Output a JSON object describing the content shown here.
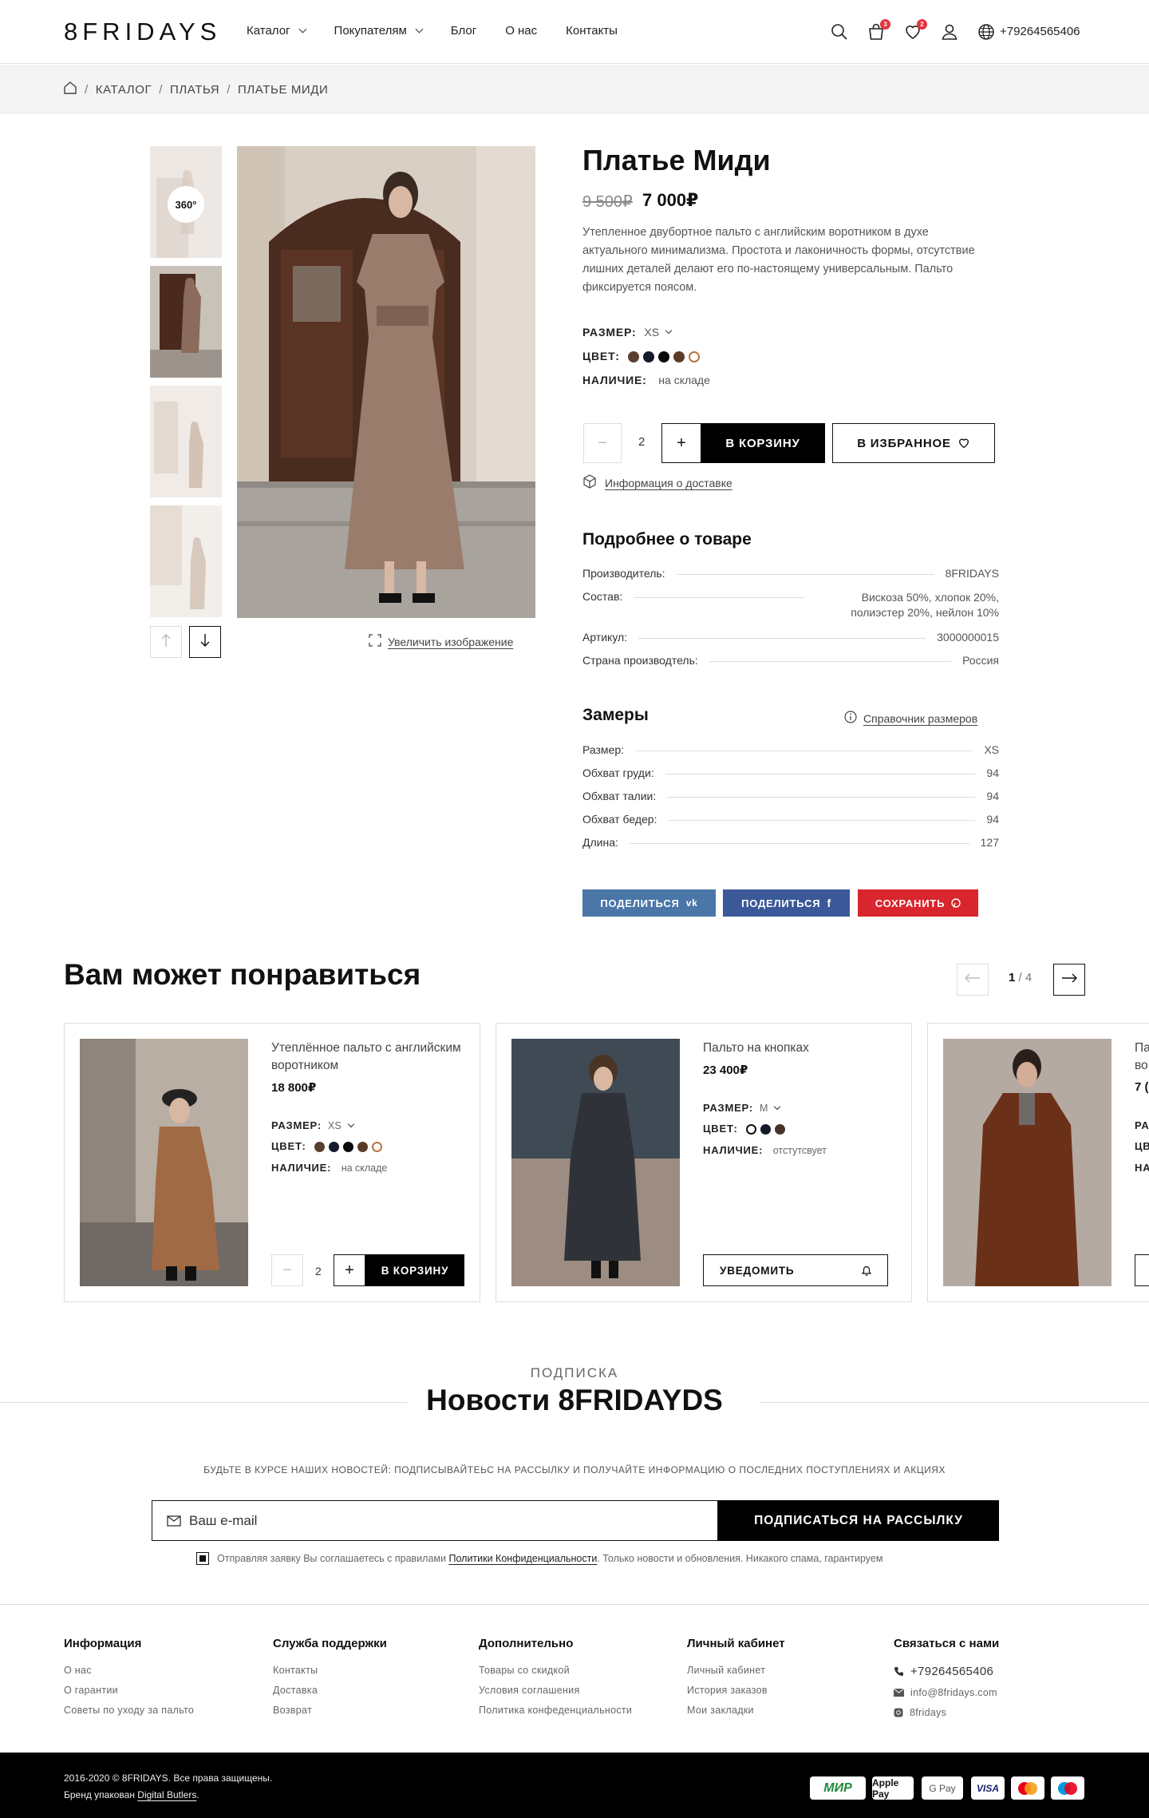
{
  "header": {
    "logo": "8FRIDAYS",
    "nav": [
      {
        "label": "Каталог",
        "has_dropdown": true
      },
      {
        "label": "Покупателям",
        "has_dropdown": true
      },
      {
        "label": "Блог",
        "has_dropdown": false
      },
      {
        "label": "О нас",
        "has_dropdown": false
      },
      {
        "label": "Контакты",
        "has_dropdown": false
      }
    ],
    "icons": [
      "search-icon",
      "cart-icon",
      "heart-icon",
      "user-icon",
      "globe-icon"
    ],
    "cart_count": "3",
    "wishlist_count": "2",
    "phone": "+79264565406"
  },
  "breadcrumb": {
    "icon": "home-icon",
    "items": [
      "КАТАЛОГ",
      "ПЛАТЬЯ",
      "ПЛАТЬЕ МИДИ"
    ],
    "separator": "/"
  },
  "gallery": {
    "badge_360": "360°",
    "zoom_label": "Увеличить изображение",
    "prev_icon": "arrow-up-icon",
    "next_icon": "arrow-down-icon",
    "thumbs_count": 4,
    "active_thumb": 2
  },
  "product": {
    "title": "Платье Миди",
    "old_price": "9 500₽",
    "price": "7 000₽",
    "description": "Утепленное двубортное пальто с английским воротником в духе актуального минимализма. Простота и лаконичность формы, отсутствие лишних деталей делают его по-настоящему универсальным. Пальто фиксируется поясом.",
    "size_label": "РАЗМЕР:",
    "size_value": "XS",
    "color_label": "ЦВЕТ:",
    "colors": [
      "#5a3e2e",
      "#151a2a",
      "#0a0a0a",
      "#5b3b27",
      "#b8733f"
    ],
    "selected_color_index": 4,
    "stock_label": "НАЛИЧИЕ:",
    "stock_value": "на складе",
    "quantity": "2",
    "add_to_cart": "В КОРЗИНУ",
    "add_to_wishlist": "В ИЗБРАННОЕ",
    "delivery_link": "Информация о доставке"
  },
  "details": {
    "title": "Подробнее о товаре",
    "rows": [
      {
        "key": "Производитель:",
        "value": "8FRIDAYS"
      },
      {
        "key": "Состав:",
        "value": "Вискоза 50%, хлопок 20%, полиэстер 20%, нейлон 10%"
      },
      {
        "key": "Артикул:",
        "value": "3000000015"
      },
      {
        "key": "Страна производтель:",
        "value": "Россия"
      }
    ]
  },
  "measurements": {
    "title": "Замеры",
    "guide_link": "Справочник размеров",
    "rows": [
      {
        "key": "Размер:",
        "value": "XS"
      },
      {
        "key": "Обхват груди:",
        "value": "94"
      },
      {
        "key": "Обхват талии:",
        "value": "94"
      },
      {
        "key": "Обхват бедер:",
        "value": "94"
      },
      {
        "key": "Длина:",
        "value": "127"
      }
    ]
  },
  "share": [
    {
      "label": "ПОДЕЛИТЬСЯ",
      "icon": "vk-icon",
      "color": "#4a76a8"
    },
    {
      "label": "ПОДЕЛИТЬСЯ",
      "icon": "facebook-icon",
      "color": "#3b5998"
    },
    {
      "label": "СОХРАНИТЬ",
      "icon": "pinterest-icon",
      "color": "#d9252d"
    }
  ],
  "recommend": {
    "title": "Вам может понравиться",
    "page_current": "1",
    "page_total": "/ 4",
    "cards": [
      {
        "name": "Утеплённое пальто с английским воротником",
        "price": "18 800₽",
        "size_label": "РАЗМЕР:",
        "size": "XS",
        "color_label": "ЦВЕТ:",
        "colors": [
          "#5a3e2e",
          "#151a2a",
          "#0a0a0a",
          "#5b3b27",
          "#b8733f"
        ],
        "stock_label": "НАЛИЧИЕ:",
        "stock": "на складе",
        "quantity": "2",
        "action": "В КОРЗИНУ"
      },
      {
        "name": "Пальто на кнопках",
        "price": "23 400₽",
        "size_label": "РАЗМЕР:",
        "size": "M",
        "color_label": "ЦВЕТ:",
        "colors": [
          "#ffffff",
          "#151a2a",
          "#4a3226"
        ],
        "stock_label": "НАЛИЧИЕ:",
        "stock": "отстутсвует",
        "action": "УВЕДОМИТЬ"
      },
      {
        "name": "Па во",
        "price": "7 (",
        "size_label": "РА",
        "color_label": "ЦВ",
        "stock_label": "НА"
      }
    ]
  },
  "subscribe": {
    "label": "ПОДПИСКА",
    "title": "Новости 8FRIDAYDS",
    "text": "БУДЬТЕ В КУРСЕ НАШИХ НОВОСТЕЙ: ПОДПИСЫВАЙТЕЬС НА РАССЫЛКУ И ПОЛУЧАЙТЕ ИНФОРМАЦИЮ О ПОСЛЕДНИХ ПОСТУПЛЕНИЯХ И АКЦИЯХ",
    "email_placeholder": "Ваш e-mail",
    "button": "ПОДПИСАТЬСЯ НА РАССЫЛКУ",
    "agree_before": "Отправляя заявку Вы соглашаетесь с правилами ",
    "agree_link": "Политики Конфиденциальности",
    "agree_after": ". Только новости и обновления. Никакого спама, гарантируем"
  },
  "footer": {
    "columns": [
      {
        "title": "Информация",
        "links": [
          "О нас",
          "О гарантии",
          "Советы по уходу за пальто"
        ]
      },
      {
        "title": "Служба поддержки",
        "links": [
          "Контакты",
          "Доставка",
          "Возврат"
        ]
      },
      {
        "title": "Дополнительно",
        "links": [
          "Товары со скидкой",
          "Условия соглашения",
          "Политика конфеденциальности"
        ]
      },
      {
        "title": "Личный кабинет",
        "links": [
          "Личный кабинет",
          "История заказов",
          "Мои закладки"
        ]
      }
    ],
    "contacts": {
      "title": "Связаться с нами",
      "phone": "+79264565406",
      "email": "info@8fridays.com",
      "instagram": "8fridays"
    },
    "copyright": "2016-2020 © 8FRIDAYS. Все права защищены.",
    "brand_before": "Бренд упакован ",
    "brand_link": "Digital Butlers",
    "brand_after": ".",
    "payments": [
      "МИР",
      "Apple Pay",
      "G Pay",
      "VISA",
      "mastercard",
      "maestro"
    ]
  }
}
